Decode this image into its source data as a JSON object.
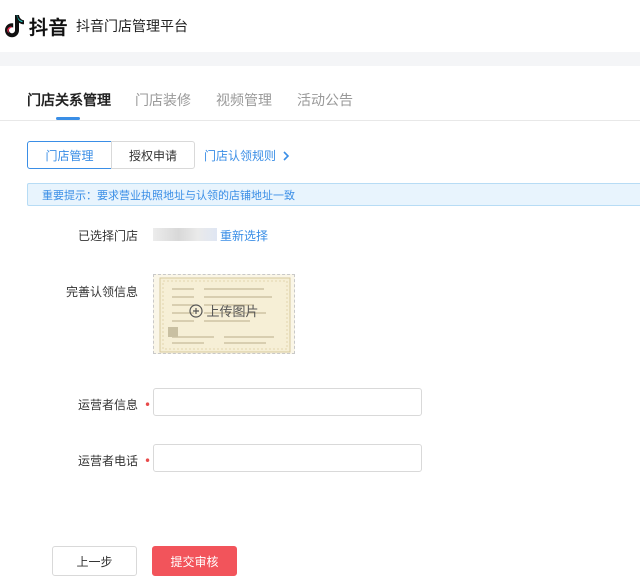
{
  "header": {
    "logo_text": "抖音",
    "platform_title": "抖音门店管理平台"
  },
  "tabs": [
    {
      "label": "门店关系管理",
      "active": true
    },
    {
      "label": "门店装修",
      "active": false
    },
    {
      "label": "视频管理",
      "active": false
    },
    {
      "label": "活动公告",
      "active": false
    }
  ],
  "segments": {
    "store_manage": "门店管理",
    "auth_apply": "授权申请",
    "rule_link": "门店认领规则"
  },
  "notice": {
    "text": "重要提示：要求营业执照地址与认领的店铺地址一致"
  },
  "form": {
    "selected_store_label": "已选择门店",
    "reselect_link": "重新选择",
    "complete_info_label": "完善认领信息",
    "upload_text": "上传图片",
    "operator_info_label": "运营者信息",
    "operator_phone_label": "运营者电话",
    "required_mark": "•"
  },
  "actions": {
    "prev_label": "上一步",
    "submit_label": "提交审核"
  },
  "colors": {
    "accent": "#3a8ee6",
    "submit": "#f2545b",
    "notice_bg": "#e8f4fd"
  }
}
